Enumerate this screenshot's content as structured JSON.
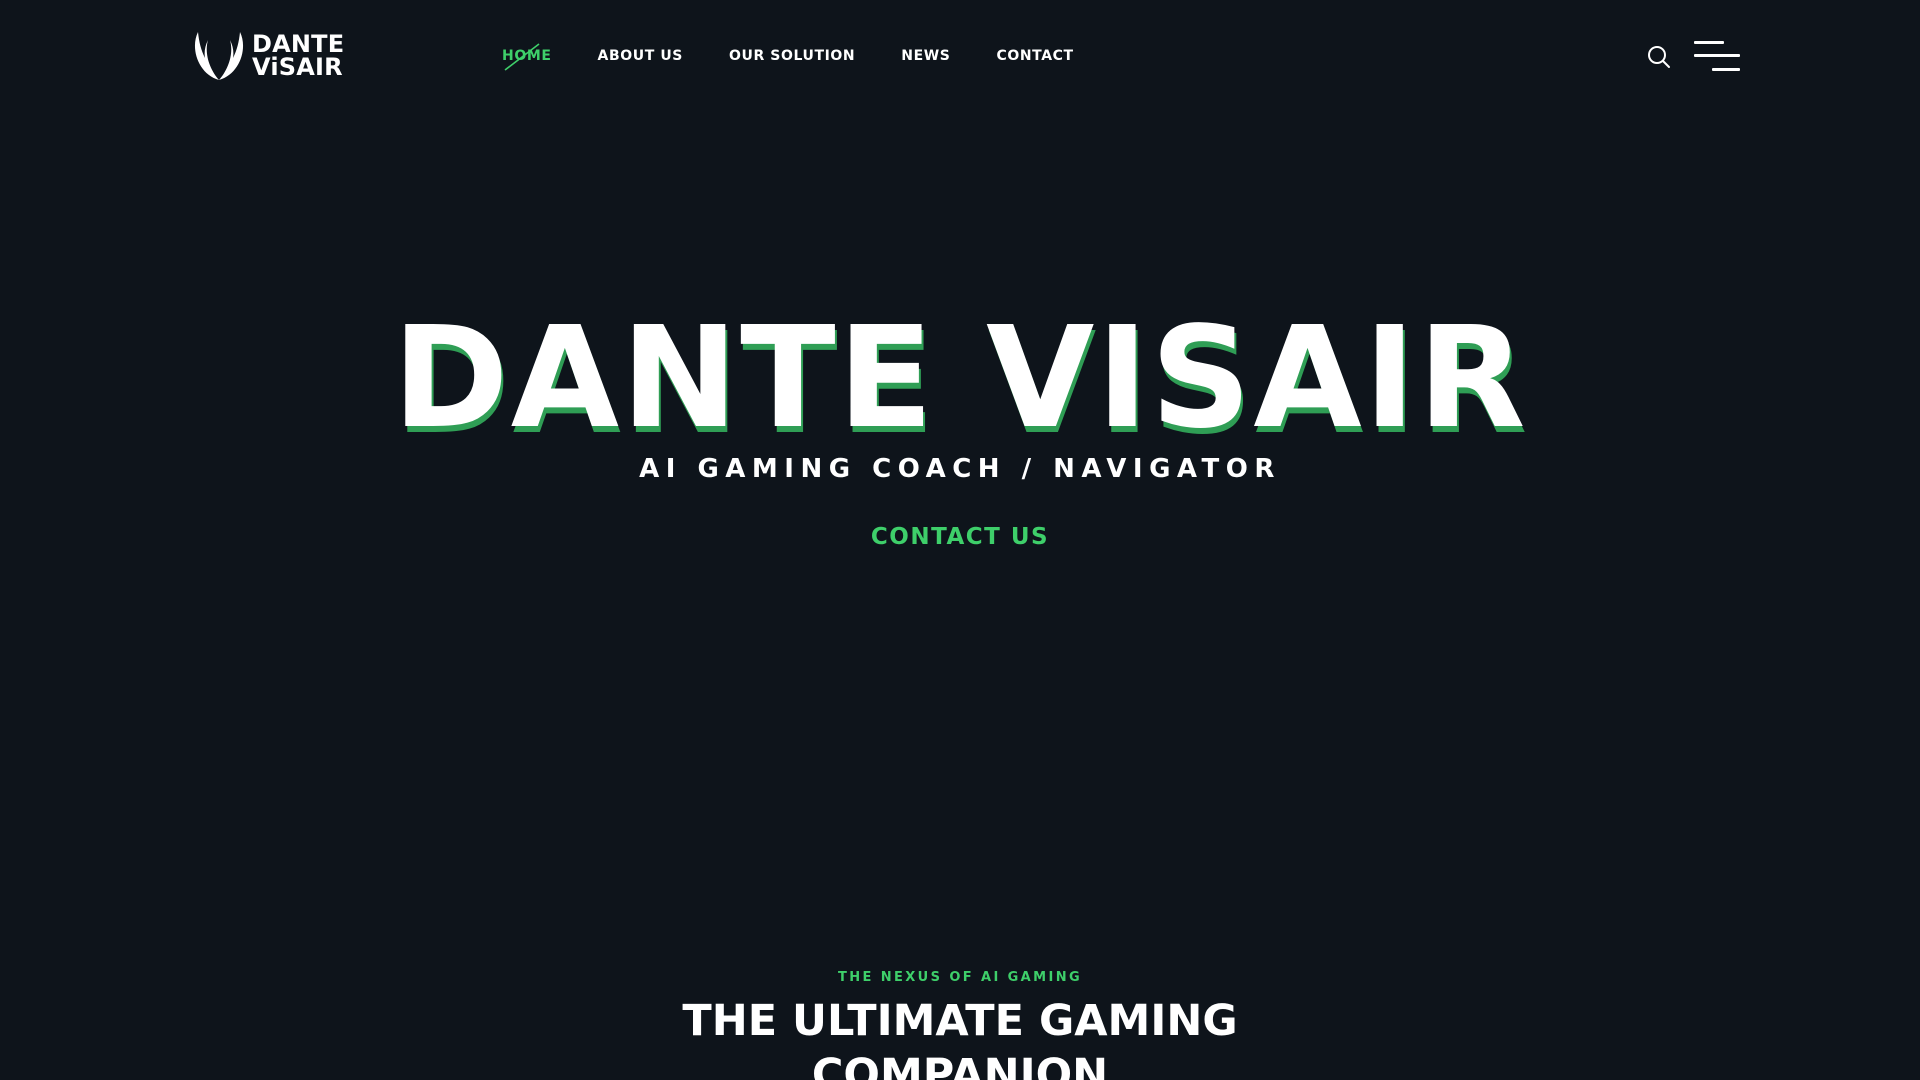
{
  "brand": {
    "logo_line1": "DANTE",
    "logo_line2": "ViSAIR"
  },
  "nav": {
    "items": [
      {
        "label": "HOME",
        "active": true
      },
      {
        "label": "ABOUT US",
        "active": false
      },
      {
        "label": "OUR SOLUTION",
        "active": false
      },
      {
        "label": "NEWS",
        "active": false
      },
      {
        "label": "CONTACT",
        "active": false
      }
    ],
    "search_icon": "search-icon",
    "menu_icon": "hamburger-menu-icon"
  },
  "hero": {
    "title": "DANTE VISAIR",
    "subtitle": "AI GAMING COACH / NAVIGATOR",
    "cta_label": "CONTACT US"
  },
  "section": {
    "eyebrow": "THE NEXUS OF AI GAMING",
    "heading_line1": "THE ULTIMATE GAMING",
    "heading_line2": "COMPANION"
  },
  "colors": {
    "background": "#0e141b",
    "accent": "#3ecf6a",
    "text": "#ffffff"
  }
}
